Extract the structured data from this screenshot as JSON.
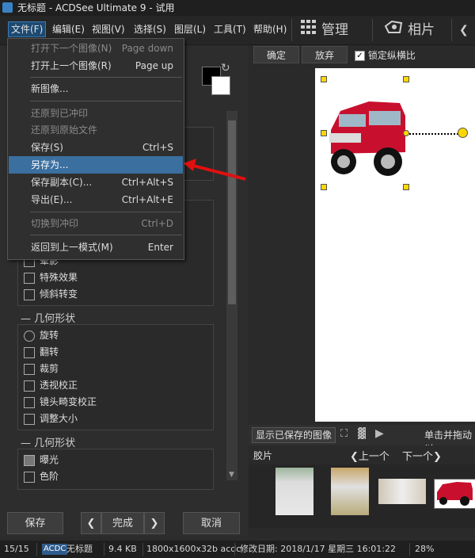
{
  "window": {
    "title": "无标题 - ACDSee Ultimate 9 - 试用"
  },
  "menubar": {
    "items": [
      "文件(F)",
      "编辑(E)",
      "视图(V)",
      "选择(S)",
      "图层(L)",
      "工具(T)",
      "帮助(H)"
    ],
    "modes": [
      "管理",
      "相片"
    ]
  },
  "file_menu": {
    "items": [
      {
        "label": "打开下一个图像(N)",
        "shortcut": "Page down",
        "disabled": true
      },
      {
        "label": "打开上一个图像(R)",
        "shortcut": "Page up",
        "disabled": false
      },
      {
        "label": "新图像...",
        "shortcut": "",
        "disabled": false
      },
      {
        "label": "还原到已冲印",
        "shortcut": "",
        "disabled": true
      },
      {
        "label": "还原到原始文件",
        "shortcut": "",
        "disabled": true
      },
      {
        "label": "保存(S)",
        "shortcut": "Ctrl+S",
        "disabled": false
      },
      {
        "label": "另存为...",
        "shortcut": "",
        "disabled": false,
        "highlighted": true
      },
      {
        "label": "保存副本(C)...",
        "shortcut": "Ctrl+Alt+S",
        "disabled": false
      },
      {
        "label": "导出(E)...",
        "shortcut": "Ctrl+Alt+E",
        "disabled": false
      },
      {
        "label": "切换到冲印",
        "shortcut": "Ctrl+D",
        "disabled": true
      },
      {
        "label": "返回到上一模式(M)",
        "shortcut": "Enter",
        "disabled": false
      }
    ]
  },
  "left_panel": {
    "partial_tools": [
      "晕影",
      "特殊效果",
      "倾斜转变"
    ],
    "geometry_section_1": {
      "title": "几何形状",
      "tools": [
        "旋转",
        "翻转",
        "裁剪",
        "透视校正",
        "镜头畸变校正",
        "调整大小"
      ]
    },
    "geometry_section_2": {
      "title": "几何形状",
      "tools": [
        "曝光",
        "色阶"
      ]
    },
    "buttons": {
      "save": "保存",
      "done": "完成",
      "cancel": "取消"
    }
  },
  "right_panel": {
    "confirm": "确定",
    "discard": "放弃",
    "lock_aspect": "锁定纵横比",
    "lock_aspect_checked": true,
    "show_saved": "显示已保存的图像",
    "drag_hint": "单击并拖动以",
    "film_label": "胶片",
    "prev": "上一个",
    "next": "下一个"
  },
  "status_bar": {
    "index": "15/15",
    "format": "ACDC",
    "filename": "无标题",
    "size": "9.4 KB",
    "dimensions": "1800x1600x32b acdc",
    "modified": "修改日期: 2018/1/17 星期三 16:01:22",
    "zoom": "28%"
  }
}
